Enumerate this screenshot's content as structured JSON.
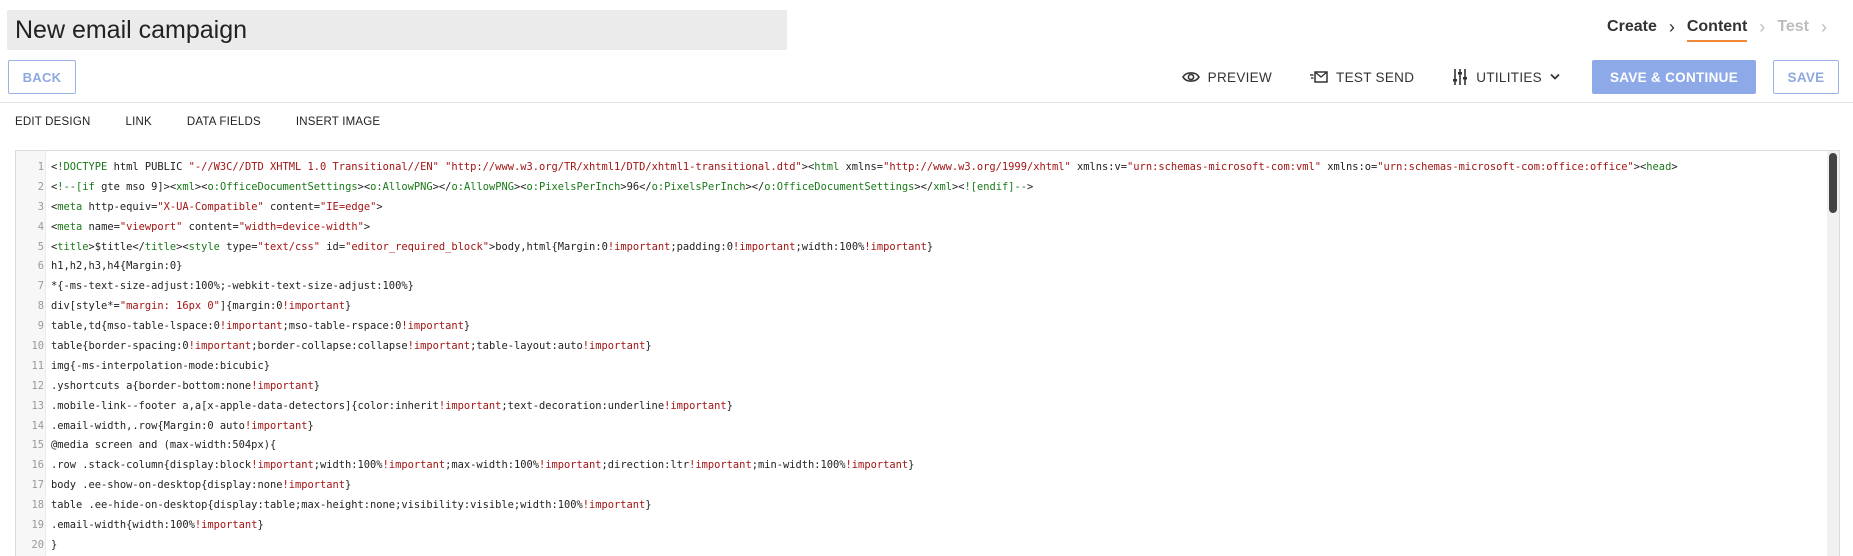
{
  "header": {
    "title": "New email campaign",
    "steps": [
      {
        "label": "Create",
        "state": "done"
      },
      {
        "label": "Content",
        "state": "active"
      },
      {
        "label": "Test",
        "state": "inactive"
      }
    ]
  },
  "actions": {
    "back": "BACK",
    "preview": "PREVIEW",
    "test_send": "TEST SEND",
    "utilities": "UTILITIES",
    "save_continue": "SAVE & CONTINUE",
    "save": "SAVE"
  },
  "editor_tabs": [
    "EDIT DESIGN",
    "LINK",
    "DATA FIELDS",
    "INSERT IMAGE"
  ],
  "colors": {
    "accent": "#8ea9e8",
    "active_step_underline": "#f0883a",
    "title_bg": "#ebebeb"
  },
  "code_lines": [
    "<!DOCTYPE html PUBLIC \"-//W3C//DTD XHTML 1.0 Transitional//EN\" \"http://www.w3.org/TR/xhtml1/DTD/xhtml1-transitional.dtd\"><html xmlns=\"http://www.w3.org/1999/xhtml\" xmlns:v=\"urn:schemas-microsoft-com:vml\" xmlns:o=\"urn:schemas-microsoft-com:office:office\"><head>",
    "<!--[if gte mso 9]><xml><o:OfficeDocumentSettings><o:AllowPNG></o:AllowPNG><o:PixelsPerInch>96</o:PixelsPerInch></o:OfficeDocumentSettings></xml><![endif]-->",
    "<meta http-equiv=\"X-UA-Compatible\" content=\"IE=edge\">",
    "<meta name=\"viewport\" content=\"width=device-width\">",
    "<title>$title</title><style type=\"text/css\" id=\"editor_required_block\">body,html{Margin:0!important;padding:0!important;width:100%!important}",
    "h1,h2,h3,h4{Margin:0}",
    "*{-ms-text-size-adjust:100%;-webkit-text-size-adjust:100%}",
    "div[style*=\"margin: 16px 0\"]{margin:0!important}",
    "table,td{mso-table-lspace:0!important;mso-table-rspace:0!important}",
    "table{border-spacing:0!important;border-collapse:collapse!important;table-layout:auto!important}",
    "img{-ms-interpolation-mode:bicubic}",
    ".yshortcuts a{border-bottom:none!important}",
    ".mobile-link--footer a,a[x-apple-data-detectors]{color:inherit!important;text-decoration:underline!important}",
    ".email-width,.row{Margin:0 auto!important}",
    "@media screen and (max-width:504px){",
    ".row .stack-column{display:block!important;width:100%!important;max-width:100%!important;direction:ltr!important;min-width:100%!important}",
    "body .ee-show-on-desktop{display:none!important}",
    "table .ee-hide-on-desktop{display:table;max-height:none;visibility:visible;width:100%!important}",
    ".email-width{width:100%!important}",
    "}"
  ]
}
